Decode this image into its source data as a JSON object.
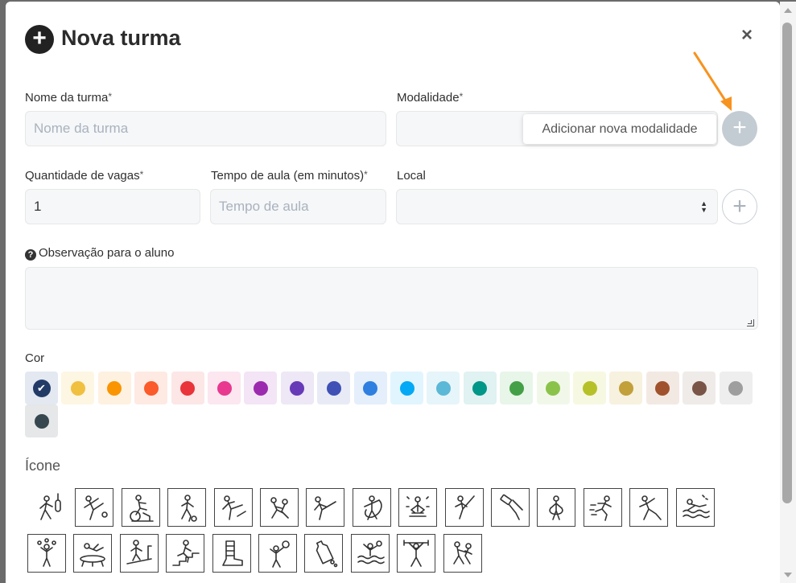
{
  "modal": {
    "title": "Nova turma",
    "close_label": "×",
    "title_icon": "plus-circle-icon"
  },
  "form": {
    "nome": {
      "label": "Nome da turma",
      "required_mark": "*",
      "placeholder": "Nome da turma",
      "value": ""
    },
    "modalidade": {
      "label": "Modalidade",
      "required_mark": "*",
      "value": "",
      "add_button": "+",
      "tooltip": "Adicionar nova modalidade"
    },
    "vagas": {
      "label": "Quantidade de vagas",
      "required_mark": "*",
      "value": "1"
    },
    "tempo": {
      "label": "Tempo de aula (em minutos)",
      "required_mark": "*",
      "placeholder": "Tempo de aula",
      "value": ""
    },
    "local": {
      "label": "Local",
      "value": "",
      "add_button": "+"
    },
    "observacao": {
      "label": "Observação para o aluno",
      "help_icon": "?",
      "value": ""
    }
  },
  "cor": {
    "label": "Cor",
    "selected_index": 0,
    "colors": [
      {
        "dot": "#223a66",
        "bg": "#e3e8f1"
      },
      {
        "dot": "#f0c040",
        "bg": "#fdf6e3"
      },
      {
        "dot": "#fa9400",
        "bg": "#fef1e0"
      },
      {
        "dot": "#fb5a2a",
        "bg": "#feeae3"
      },
      {
        "dot": "#e8343a",
        "bg": "#fce6e6"
      },
      {
        "dot": "#e8388f",
        "bg": "#fce6f0"
      },
      {
        "dot": "#9c2aae",
        "bg": "#f3e5f5"
      },
      {
        "dot": "#673ab7",
        "bg": "#ede7f6"
      },
      {
        "dot": "#3f51b5",
        "bg": "#e8eaf6"
      },
      {
        "dot": "#2f7fe0",
        "bg": "#e4effb"
      },
      {
        "dot": "#03a9f4",
        "bg": "#e1f5fe"
      },
      {
        "dot": "#5bb8d6",
        "bg": "#e6f5f9"
      },
      {
        "dot": "#009688",
        "bg": "#e0f2f1"
      },
      {
        "dot": "#43a047",
        "bg": "#e8f5e9"
      },
      {
        "dot": "#8bc34a",
        "bg": "#f1f8e9"
      },
      {
        "dot": "#b6c12a",
        "bg": "#f7f8e1"
      },
      {
        "dot": "#c2a03a",
        "bg": "#f7f1df"
      },
      {
        "dot": "#a0522d",
        "bg": "#f3e9e3"
      },
      {
        "dot": "#795548",
        "bg": "#efebe9"
      },
      {
        "dot": "#9e9e9e",
        "bg": "#eeeeee"
      },
      {
        "dot": "#37474f",
        "bg": "#e5e7e8"
      }
    ]
  },
  "icone": {
    "label": "Ícone",
    "icons": [
      "boxing-icon",
      "kick-icon",
      "spinning-bike-icon",
      "soccer-icon",
      "martial-kick-icon",
      "judo-throw-icon",
      "taekwondo-icon",
      "gymnastics-ribbon-icon",
      "meditation-icon",
      "high-kick-icon",
      "painting-roller-icon",
      "jump-rope-icon",
      "running-icon",
      "dance-icon",
      "swimming-icon",
      "juggling-icon",
      "trampoline-icon",
      "treadmill-icon",
      "stairs-climb-icon",
      "boot-icon",
      "volleyball-icon",
      "water-bottle-icon",
      "water-polo-icon",
      "weightlifting-icon",
      "wrestling-icon"
    ]
  }
}
